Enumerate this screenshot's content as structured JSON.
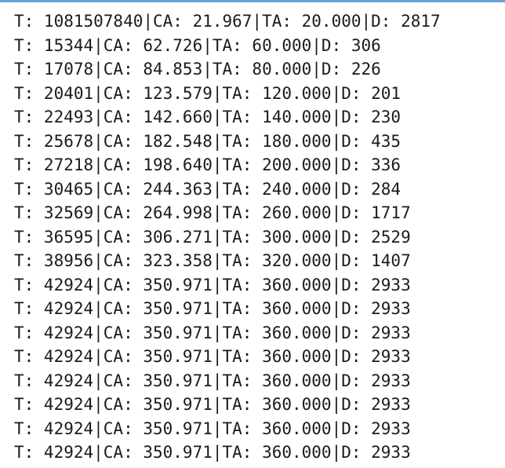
{
  "console": {
    "lines": [
      "T: 1081507840|CA: 21.967|TA: 20.000|D: 2817",
      "T: 15344|CA: 62.726|TA: 60.000|D: 306",
      "T: 17078|CA: 84.853|TA: 80.000|D: 226",
      "T: 20401|CA: 123.579|TA: 120.000|D: 201",
      "T: 22493|CA: 142.660|TA: 140.000|D: 230",
      "T: 25678|CA: 182.548|TA: 180.000|D: 435",
      "T: 27218|CA: 198.640|TA: 200.000|D: 336",
      "T: 30465|CA: 244.363|TA: 240.000|D: 284",
      "T: 32569|CA: 264.998|TA: 260.000|D: 1717",
      "T: 36595|CA: 306.271|TA: 300.000|D: 2529",
      "T: 38956|CA: 323.358|TA: 320.000|D: 1407",
      "T: 42924|CA: 350.971|TA: 360.000|D: 2933",
      "T: 42924|CA: 350.971|TA: 360.000|D: 2933",
      "T: 42924|CA: 350.971|TA: 360.000|D: 2933",
      "T: 42924|CA: 350.971|TA: 360.000|D: 2933",
      "T: 42924|CA: 350.971|TA: 360.000|D: 2933",
      "T: 42924|CA: 350.971|TA: 360.000|D: 2933",
      "T: 42924|CA: 350.971|TA: 360.000|D: 2933",
      "T: 42924|CA: 350.971|TA: 360.000|D: 2933"
    ]
  }
}
